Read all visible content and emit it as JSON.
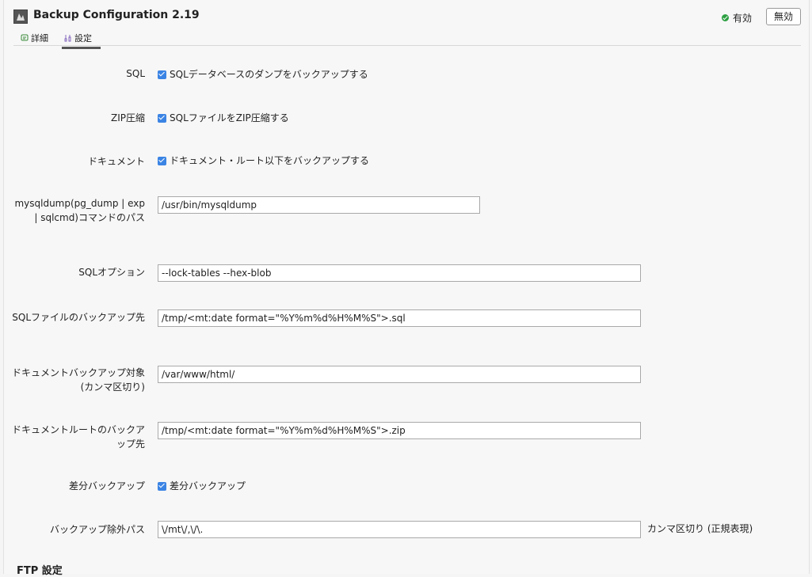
{
  "header": {
    "title": "Backup Configuration 2.19",
    "status_label": "有効",
    "disable_label": "無効"
  },
  "tabs": [
    {
      "label": "詳細",
      "icon": "detail-icon"
    },
    {
      "label": "設定",
      "icon": "settings-icon",
      "active": true
    }
  ],
  "form": {
    "sql": {
      "label": "SQL",
      "checkbox_label": "SQLデータベースのダンプをバックアップする",
      "checked": true
    },
    "zip": {
      "label": "ZIP圧縮",
      "checkbox_label": "SQLファイルをZIP圧縮する",
      "checked": true
    },
    "document": {
      "label": "ドキュメント",
      "checkbox_label": "ドキュメント・ルート以下をバックアップする",
      "checked": true
    },
    "mysqldump_path": {
      "label": "mysqldump(pg_dump | exp | sqlcmd)コマンドのパス",
      "value": "/usr/bin/mysqldump"
    },
    "sql_options": {
      "label": "SQLオプション",
      "value": "--lock-tables --hex-blob"
    },
    "sql_backup_dest": {
      "label": "SQLファイルのバックアップ先",
      "value": "/tmp/<mt:date format=\"%Y%m%d%H%M%S\">.sql"
    },
    "doc_backup_target": {
      "label": "ドキュメントバックアップ対象(カンマ区切り)",
      "value": "/var/www/html/"
    },
    "doc_root_backup_dest": {
      "label": "ドキュメントルートのバックアップ先",
      "value": "/tmp/<mt:date format=\"%Y%m%d%H%M%S\">.zip"
    },
    "diff_backup": {
      "label": "差分バックアップ",
      "checkbox_label": "差分バックアップ",
      "checked": true
    },
    "exclude_path": {
      "label": "バックアップ除外パス",
      "value": "\\/mt\\/,\\/\\.",
      "hint": "カンマ区切り (正規表現)"
    }
  },
  "ftp_section": {
    "heading": "FTP 設定"
  },
  "colors": {
    "checkbox": "#3b84e4",
    "status_ok": "#2ea043"
  }
}
